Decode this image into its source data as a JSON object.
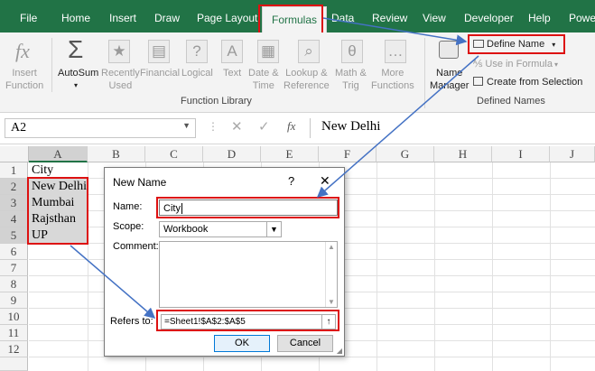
{
  "tabs": [
    "File",
    "Home",
    "Insert",
    "Draw",
    "Page Layout",
    "Formulas",
    "Data",
    "Review",
    "View",
    "Developer",
    "Help",
    "Powe"
  ],
  "active_tab": "Formulas",
  "ribbon": {
    "insert_function": "Insert\nFunction",
    "autosum": "AutoSum",
    "recently_used": "Recently\nUsed",
    "financial": "Financial",
    "logical": "Logical",
    "text": "Text",
    "date_time": "Date &\nTime",
    "lookup_reference": "Lookup &\nReference",
    "math_trig": "Math &\nTrig",
    "more_functions": "More\nFunctions",
    "function_library": "Function Library",
    "name_manager": "Name\nManager",
    "define_name": "Define Name",
    "use_in_formula": "Use in Formula",
    "create_from_selection": "Create from Selection",
    "defined_names": "Defined Names"
  },
  "formula_bar": {
    "name_box": "A2",
    "fx": "fx",
    "value": "New Delhi"
  },
  "columns": [
    "A",
    "B",
    "C",
    "D",
    "E",
    "F",
    "G",
    "H",
    "I",
    "J"
  ],
  "rows": [
    "1",
    "2",
    "3",
    "4",
    "5",
    "6",
    "7",
    "8",
    "9",
    "10",
    "11",
    "12"
  ],
  "cells": [
    "City",
    "New Delhi",
    "Mumbai",
    "Rajsthan",
    "UP"
  ],
  "dialog": {
    "title": "New Name",
    "help": "?",
    "close": "✕",
    "name_label": "Name:",
    "name_value": "City",
    "scope_label": "Scope:",
    "scope_value": "Workbook",
    "comment_label": "Comment:",
    "refers_label": "Refers to:",
    "refers_value": "=Sheet1!$A$2:$A$5",
    "ok": "OK",
    "cancel": "Cancel"
  },
  "colors": {
    "excel_green": "#217346",
    "annotation_red": "#d11111",
    "arrow_blue": "#4472c4"
  }
}
